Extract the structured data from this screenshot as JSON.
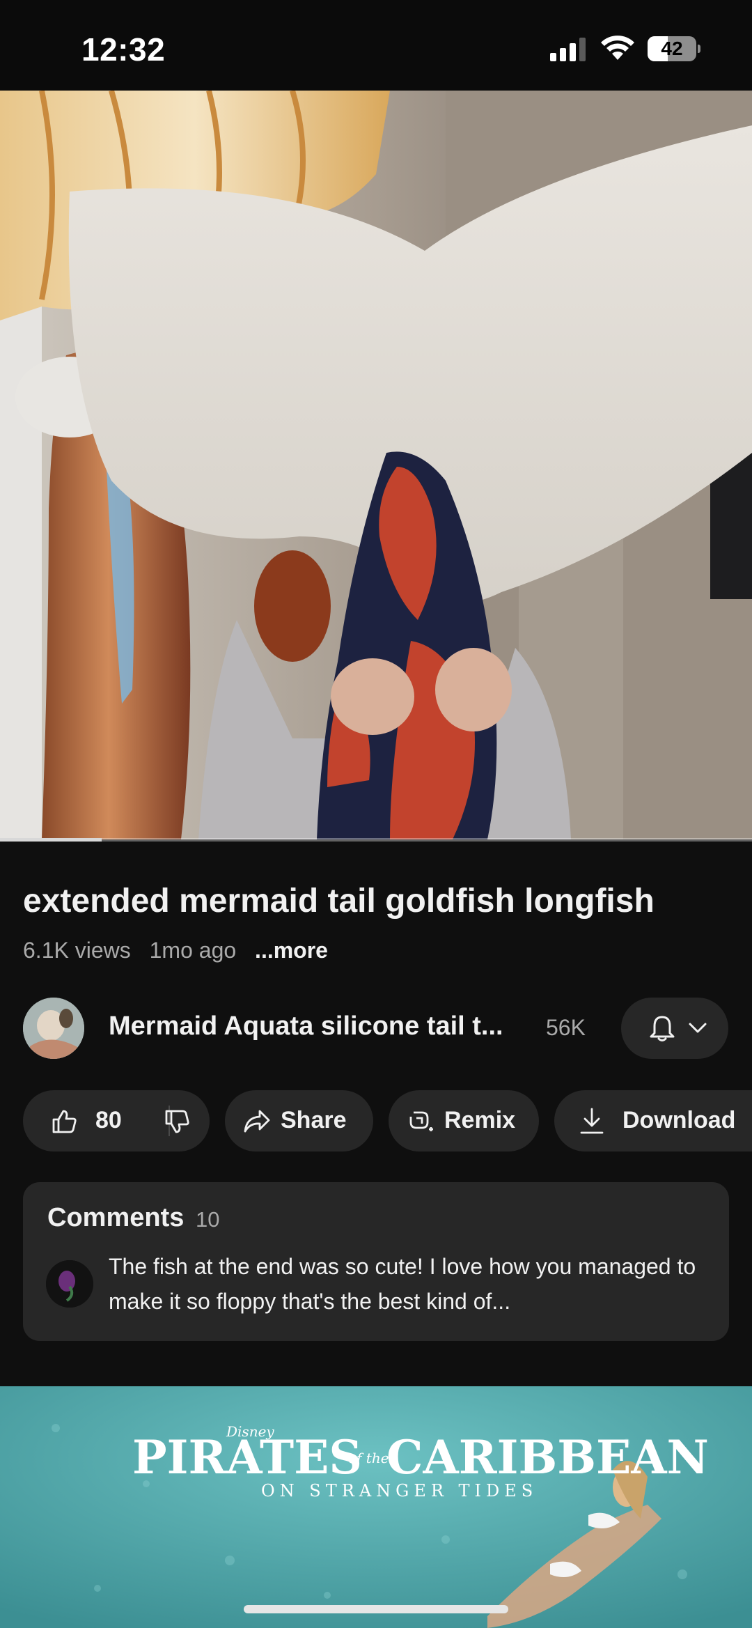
{
  "status_bar": {
    "time": "12:32",
    "battery_level": "42",
    "battery_fraction": 0.42
  },
  "video": {
    "progress_fraction": 0.135,
    "title": "extended mermaid tail goldfish longfish",
    "views": "6.1K views",
    "age": "1mo ago",
    "more_label": "...more"
  },
  "channel": {
    "name": "Mermaid Aquata silicone tail t...",
    "subscribers": "56K",
    "bell_icon": "bell-icon",
    "dropdown_icon": "chevron-down-icon"
  },
  "actions": {
    "like_count": "80",
    "share_label": "Share",
    "remix_label": "Remix",
    "download_label": "Download"
  },
  "comments": {
    "heading": "Comments",
    "count": "10",
    "top_comment": "The fish at the end was so cute! I love how you managed to make it so floppy that's the best kind of..."
  },
  "next_video": {
    "title_main": "PIRATES",
    "title_of_the": "of the",
    "title_caribbean": "CARIBBEAN",
    "subtitle": "ON STRANGER TIDES",
    "brand": "Disney"
  },
  "colors": {
    "background": "#0f0f0f",
    "surface": "#272727",
    "text_primary": "#f1f1f1",
    "text_secondary": "#aaaaaa"
  }
}
